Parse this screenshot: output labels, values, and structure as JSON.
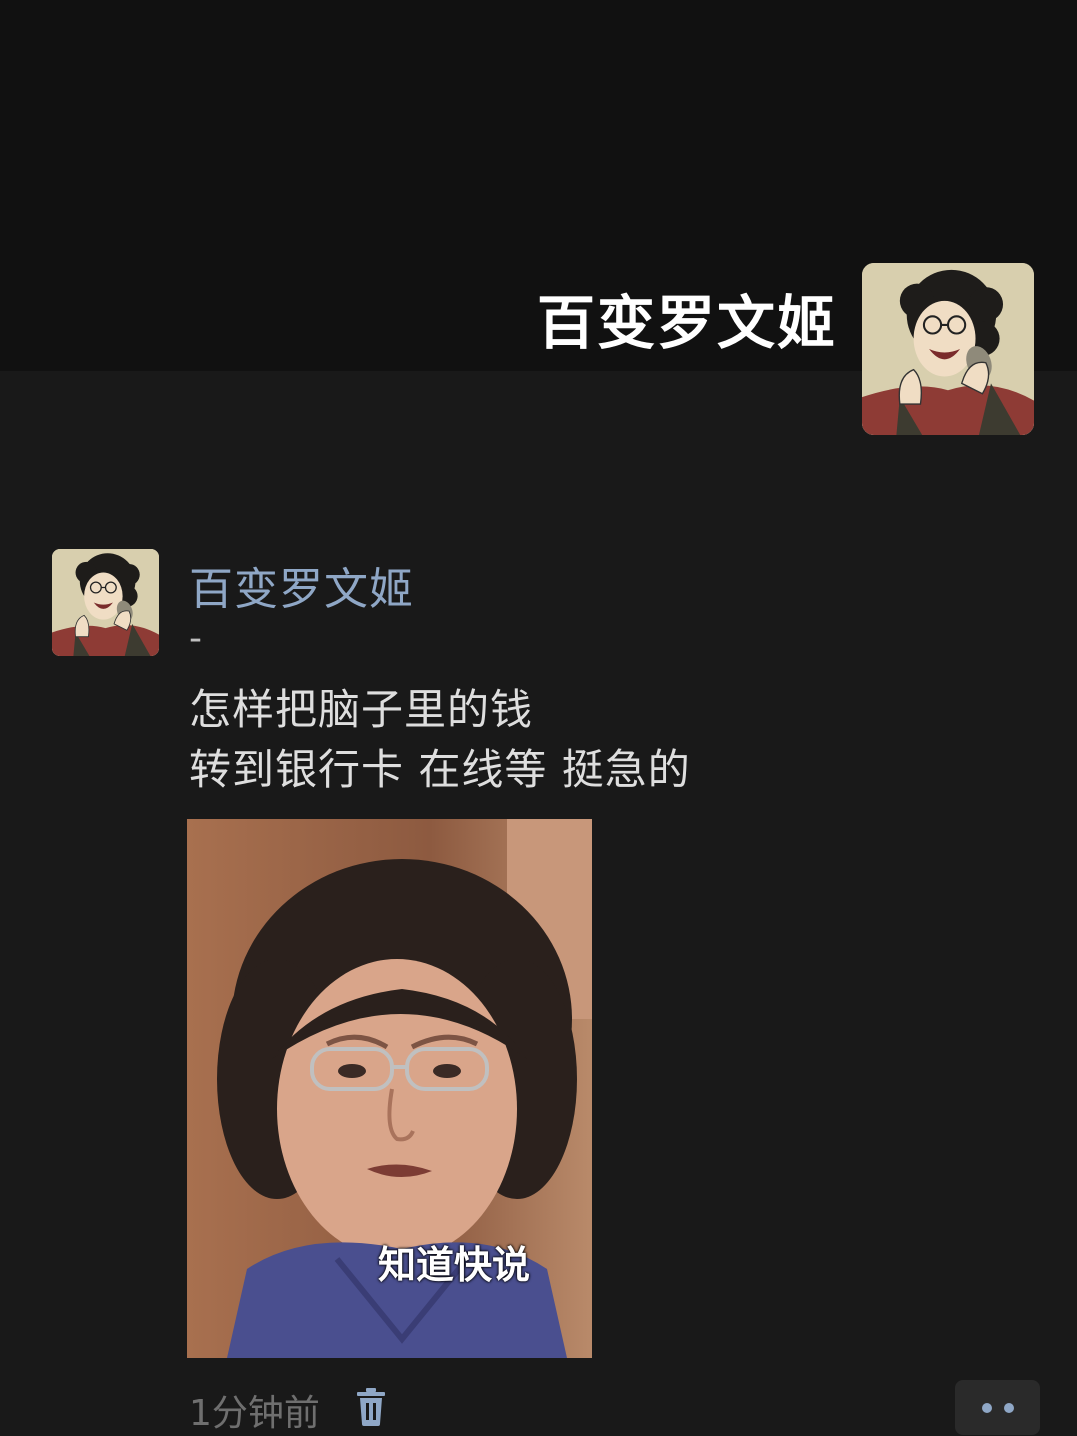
{
  "profile": {
    "name": "百变罗文姬",
    "avatar_icon": "cartoon-woman-on-phone-avatar"
  },
  "post": {
    "author": "百变罗文姬",
    "separator": "-",
    "lines": [
      "怎样把脑子里的钱",
      "转到银行卡 在线等 挺急的"
    ],
    "image": {
      "caption": "知道快说"
    },
    "time": "1分钟前",
    "delete_icon": "trash-icon",
    "more_icon": "more-dots-icon"
  },
  "colors": {
    "background": "#191919",
    "header_background": "#111111",
    "name_link": "#8fa7c6",
    "text": "#dedede",
    "muted": "#6f6f6f"
  }
}
